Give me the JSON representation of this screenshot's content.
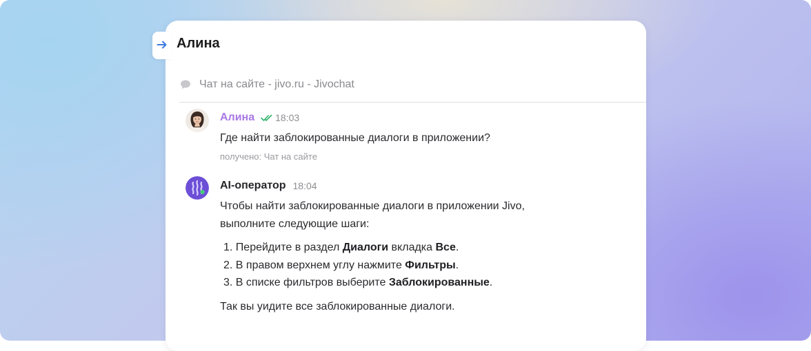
{
  "conversation": {
    "contact_name": "Алина",
    "channel": "Чат на сайте - jivo.ru - Jivochat"
  },
  "messages": {
    "client": {
      "author": "Алина",
      "time": "18:03",
      "text": "Где найти заблокированные диалоги в приложении?",
      "received": "получено: Чат на сайте"
    },
    "ai": {
      "author": "AI-оператор",
      "time": "18:04",
      "intro_line1": "Чтобы найти заблокированные диалоги в приложении Jivo,",
      "intro_line2": "выполните следующие шаги:",
      "steps": [
        {
          "num": "1.",
          "pre": "Перейдите в раздел",
          "b1": "Диалоги",
          "mid": "вкладка",
          "b2": "Все",
          "post": "."
        },
        {
          "num": "2.",
          "pre": "В правом верхнем углу нажмите",
          "b1": "Фильтры",
          "post": "."
        },
        {
          "num": "3.",
          "pre": "В списке фильтров выберите",
          "b1": "Заблокированные",
          "post": "."
        }
      ],
      "outro": "Так вы уидите все заблокированные диалоги."
    }
  },
  "icons": {
    "back": "arrow-right-icon",
    "channel": "chat-bubble-icon",
    "read": "double-check-icon",
    "ai_avatar": "ai-operator-icon"
  },
  "colors": {
    "accent_blue": "#3d7be0",
    "client_name": "#a878e6",
    "read_check": "#2fb36a",
    "ai_avatar": "#6c4fd6"
  }
}
